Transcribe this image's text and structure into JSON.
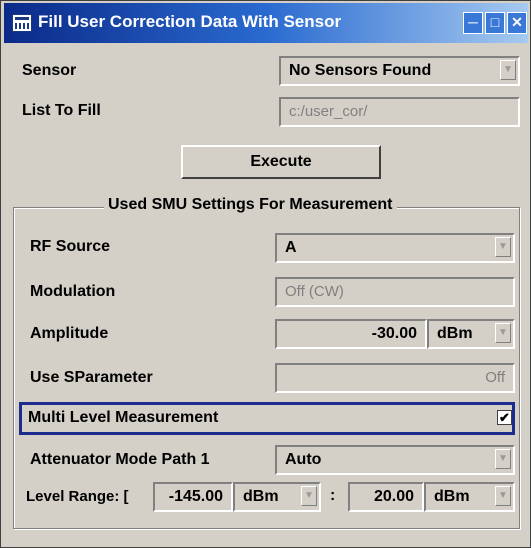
{
  "window": {
    "title": "Fill User Correction Data With Sensor"
  },
  "sensor": {
    "label": "Sensor",
    "value": "No Sensors Found"
  },
  "list_to_fill": {
    "label": "List To Fill",
    "value": "c:/user_cor/"
  },
  "execute": {
    "label": "Execute"
  },
  "settings": {
    "title": "Used SMU Settings For Measurement",
    "rf_source": {
      "label": "RF Source",
      "value": "A"
    },
    "modulation": {
      "label": "Modulation",
      "value": "Off (CW)"
    },
    "amplitude": {
      "label": "Amplitude",
      "value": "-30.00",
      "unit": "dBm"
    },
    "use_sparameter": {
      "label": "Use SParameter",
      "value": "Off"
    },
    "multi_level": {
      "label": "Multi Level Measurement",
      "checked": true,
      "check_mark": "✔"
    },
    "attenuator": {
      "label": "Attenuator Mode Path 1",
      "value": "Auto"
    },
    "level_range": {
      "label": "Level Range: [",
      "min_value": "-145.00",
      "min_unit": "dBm",
      "separator": ":",
      "max_value": "20.00",
      "max_unit": "dBm"
    }
  },
  "icons": [
    "app-icon",
    "minimize-icon",
    "maximize-icon",
    "close-icon",
    "dropdown-arrow-icon",
    "checkbox-icon"
  ]
}
